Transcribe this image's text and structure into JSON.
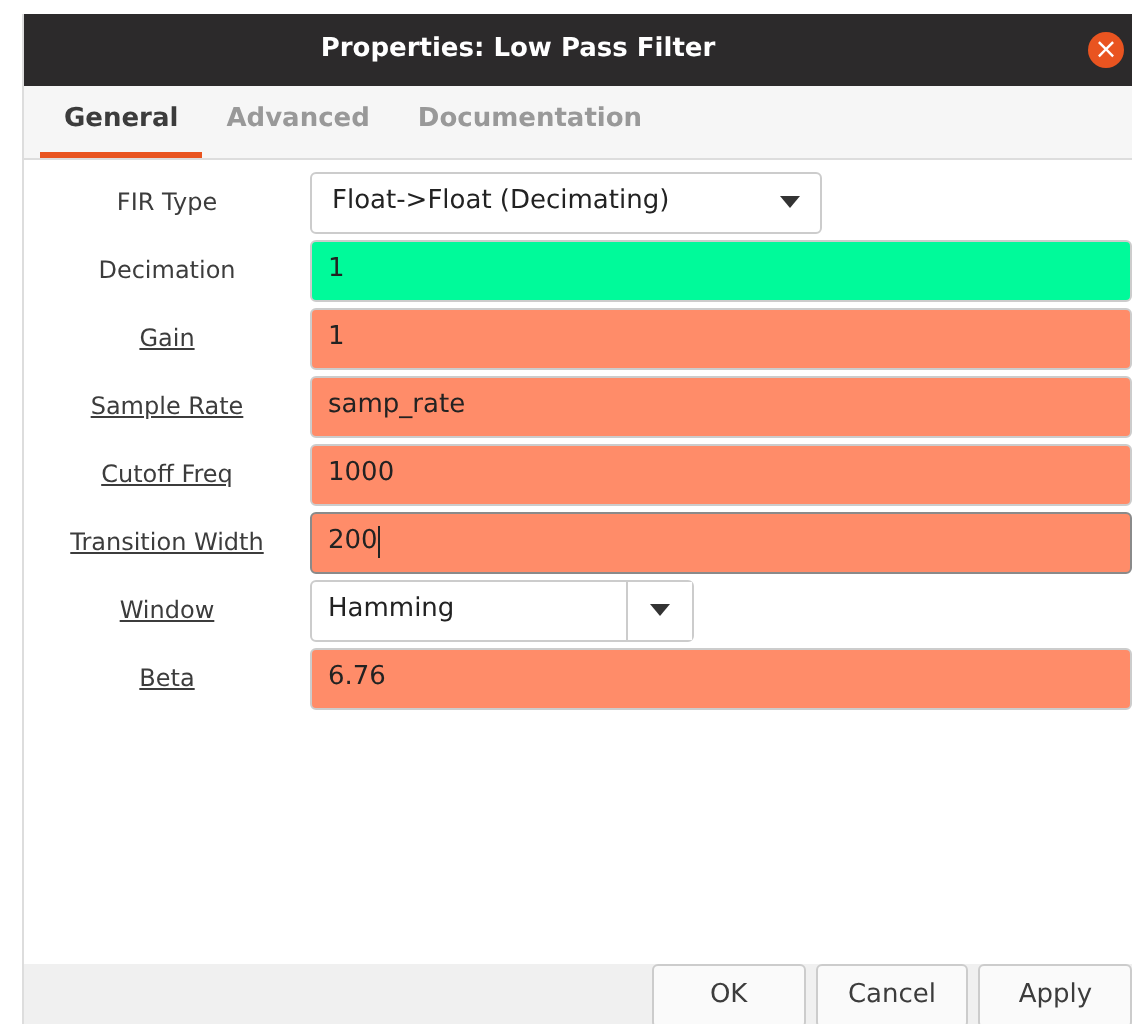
{
  "window": {
    "title": "Properties: Low Pass Filter",
    "close_icon": "×"
  },
  "tabs": [
    {
      "label": "General",
      "selected": true
    },
    {
      "label": "Advanced",
      "selected": false
    },
    {
      "label": "Documentation",
      "selected": false
    }
  ],
  "params": [
    {
      "label": "FIR Type",
      "underlined": false,
      "kind": "dropdown",
      "value": "Float->Float (Decimating)"
    },
    {
      "label": "Decimation",
      "underlined": false,
      "kind": "entry",
      "value": "1",
      "color": "#00fa9a",
      "focused": false
    },
    {
      "label": "Gain",
      "underlined": true,
      "kind": "entry",
      "value": "1",
      "color": "#ff8c69",
      "focused": false
    },
    {
      "label": "Sample Rate",
      "underlined": true,
      "kind": "entry",
      "value": "samp_rate",
      "color": "#ff8c69",
      "focused": false
    },
    {
      "label": "Cutoff Freq",
      "underlined": true,
      "kind": "entry",
      "value": "1000",
      "color": "#ff8c69",
      "focused": false
    },
    {
      "label": "Transition Width",
      "underlined": true,
      "kind": "entry",
      "value": "200",
      "color": "#ff8c69",
      "focused": true
    },
    {
      "label": "Window",
      "underlined": true,
      "kind": "combo",
      "value": "Hamming"
    },
    {
      "label": "Beta",
      "underlined": true,
      "kind": "entry",
      "value": "6.76",
      "color": "#ff8c69",
      "focused": false
    }
  ],
  "buttons": [
    "OK",
    "Cancel",
    "Apply"
  ]
}
